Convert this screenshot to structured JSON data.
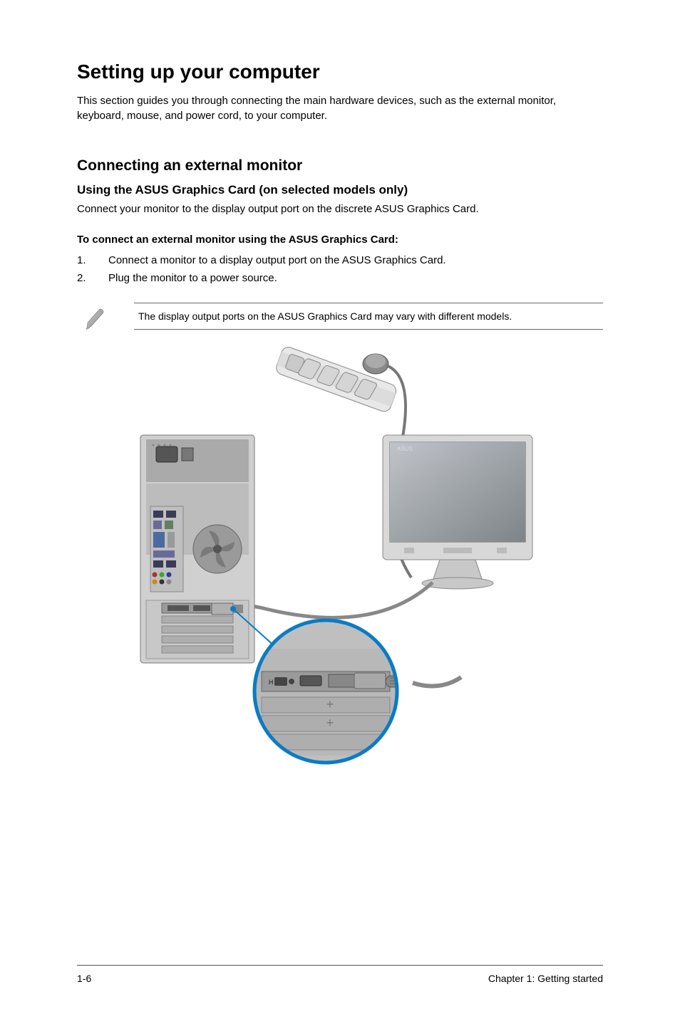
{
  "heading": "Setting up your computer",
  "intro": "This section guides you through connecting the main hardware devices, such as the external monitor, keyboard, mouse, and power cord, to your computer.",
  "section_h2": "Connecting an external monitor",
  "section_h3": "Using the ASUS Graphics Card (on selected models only)",
  "section_desc": "Connect your monitor to the display output port on the discrete ASUS Graphics Card.",
  "procedure_title": "To connect an external monitor using the ASUS Graphics Card:",
  "steps": [
    {
      "num": "1.",
      "text": "Connect a monitor to a display output port on the ASUS Graphics Card."
    },
    {
      "num": "2.",
      "text": "Plug the monitor to a power source."
    }
  ],
  "note_text": "The display output ports on the ASUS Graphics Card may vary with different models.",
  "footer_left": "1-6",
  "footer_right": "Chapter 1: Getting started"
}
